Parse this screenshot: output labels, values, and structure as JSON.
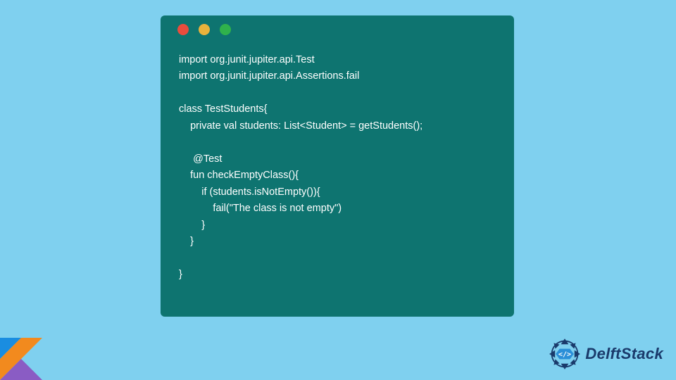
{
  "window": {
    "dots": [
      "red",
      "yellow",
      "green"
    ]
  },
  "code": {
    "lines": [
      "import org.junit.jupiter.api.Test",
      "import org.junit.jupiter.api.Assertions.fail",
      "",
      "class TestStudents{",
      "    private val students: List<Student> = getStudents();",
      "",
      "     @Test",
      "    fun checkEmptyClass(){",
      "        if (students.isNotEmpty()){",
      "            fail(\"The class is not empty\")",
      "        }",
      "    }",
      "",
      "}"
    ]
  },
  "brand": {
    "name": "DelftStack"
  },
  "colors": {
    "page_bg": "#7fd0ef",
    "window_bg": "#0e7470",
    "code_fg": "#ffffff",
    "brand_fg": "#1a3a6b"
  }
}
